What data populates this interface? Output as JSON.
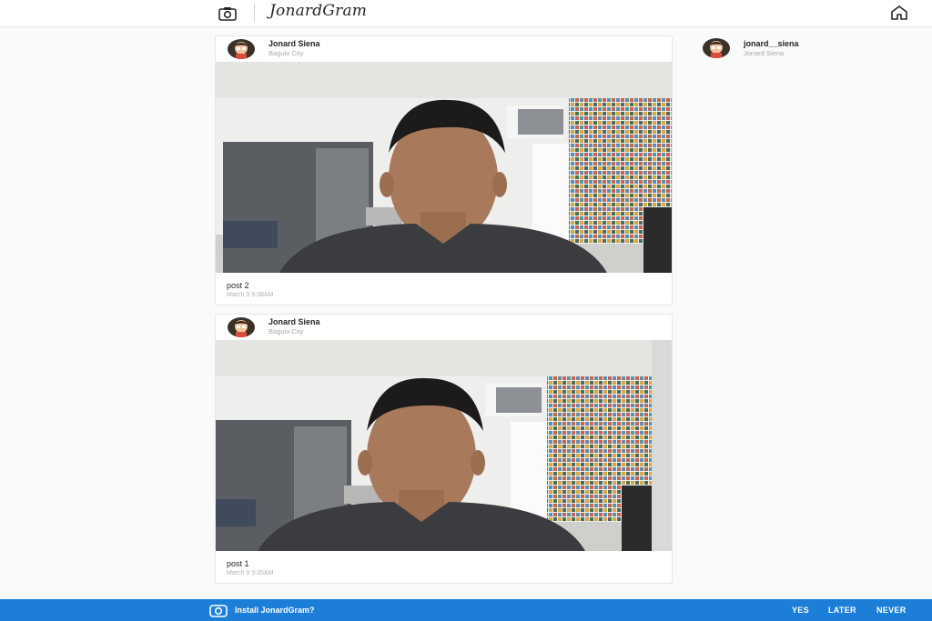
{
  "app": {
    "brand": "JonardGram"
  },
  "header": {
    "camera_icon": "camera-icon",
    "home_icon": "home-icon"
  },
  "posts": [
    {
      "author": "Jonard Siena",
      "location": "Baguio City",
      "caption": "post 2",
      "timestamp": "March 9 9:38AM"
    },
    {
      "author": "Jonard Siena",
      "location": "Baguio City",
      "caption": "post 1",
      "timestamp": "March 9 9:35AM"
    }
  ],
  "sidebar": {
    "username": "jonard__siena",
    "full_name": "Jonard Siena"
  },
  "install_banner": {
    "message": "Install JonardGram?",
    "yes": "YES",
    "later": "LATER",
    "never": "NEVER"
  },
  "colors": {
    "banner": "#1c7ed6",
    "background": "#fafafa"
  }
}
